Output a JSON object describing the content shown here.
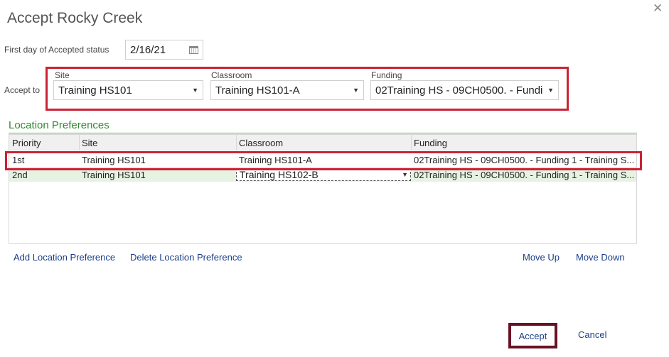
{
  "dialog": {
    "title": "Accept Rocky Creek",
    "close_glyph": "✕"
  },
  "first_day": {
    "label": "First day of Accepted status",
    "value": "2/16/21"
  },
  "accept_to": {
    "label": "Accept to",
    "site": {
      "label": "Site",
      "value": "Training HS101"
    },
    "classroom": {
      "label": "Classroom",
      "value": "Training HS101-A"
    },
    "funding": {
      "label": "Funding",
      "value": "02Training HS - 09CH0500. - Fundi..."
    }
  },
  "preferences": {
    "title": "Location Preferences",
    "columns": [
      "Priority",
      "Site",
      "Classroom",
      "Funding"
    ],
    "rows": [
      {
        "priority": "1st",
        "site": "Training HS101",
        "classroom": "Training HS101-A",
        "funding": "02Training HS - 09CH0500. - Funding 1 - Training S..."
      },
      {
        "priority": "2nd",
        "site": "Training HS101",
        "classroom": "Training HS102-B",
        "funding": "02Training HS - 09CH0500. - Funding 1 - Training S..."
      }
    ]
  },
  "actions": {
    "add": "Add Location Preference",
    "delete": "Delete Location Preference",
    "move_up": "Move Up",
    "move_down": "Move Down"
  },
  "footer": {
    "accept": "Accept",
    "cancel": "Cancel"
  },
  "colors": {
    "highlight_red": "#cc2233",
    "accept_border": "#6a1225",
    "section_green": "#2e8b2e",
    "link_blue": "#1a3e8a"
  }
}
